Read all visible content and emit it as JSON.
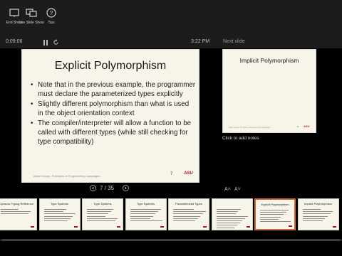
{
  "toolbar": {
    "buttons": [
      {
        "label": "End Show",
        "icon": "end-show-icon"
      },
      {
        "label": "Use Slide Show",
        "icon": "monitor-icon"
      },
      {
        "label": "Tips",
        "icon": "help-icon"
      }
    ]
  },
  "status": {
    "timer": "0:09:06",
    "clock": "3:22 PM",
    "next_slide_label": "Next slide"
  },
  "current_slide": {
    "title": "Explicit Polymorphism",
    "bullets": [
      "Note that in the previous example, the programmer must declare the parameterized types explicitly",
      "Slightly different polymorphism than what is used in the object orientation context",
      "The compiler/interpreter will allow a function to be called with different types (while still checking for type compatibility)"
    ],
    "footer": "Adam Doupé, Principles of Programming Languages",
    "page_number": "7",
    "logo_text": "ASU"
  },
  "navigation": {
    "counter": "7 / 35"
  },
  "next_slide": {
    "title": "Implicit Polymorphism",
    "footer": "Adam Doupé, Principles of Programming Languages",
    "page_number": "8",
    "logo_text": "ASU"
  },
  "notes": {
    "placeholder": "Click to add notes",
    "font_increase": "A˄",
    "font_decrease": "A˅"
  },
  "filmstrip": {
    "active_index": 6,
    "thumbs": [
      {
        "title": "Dynamic Typing Reference",
        "lines": 3
      },
      {
        "title": "Type Systems",
        "lines": 6
      },
      {
        "title": "Type Systems",
        "lines": 6
      },
      {
        "title": "Type Systems",
        "lines": 6
      },
      {
        "title": "Parameterized Types",
        "lines": 6
      },
      {
        "title": "",
        "lines": 9
      },
      {
        "title": "Explicit Polymorphism",
        "lines": 6
      },
      {
        "title": "Implicit Polymorphism",
        "lines": 6
      }
    ]
  },
  "colors": {
    "accent": "#d06a3a",
    "slide_bg": "#f7f5ea",
    "logo": "#9b1b30"
  }
}
